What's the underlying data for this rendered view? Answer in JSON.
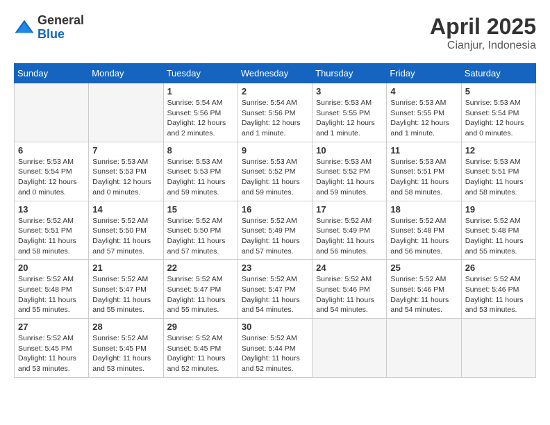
{
  "header": {
    "logo_general": "General",
    "logo_blue": "Blue",
    "month_year": "April 2025",
    "location": "Cianjur, Indonesia"
  },
  "days_of_week": [
    "Sunday",
    "Monday",
    "Tuesday",
    "Wednesday",
    "Thursday",
    "Friday",
    "Saturday"
  ],
  "weeks": [
    [
      {
        "day": "",
        "info": ""
      },
      {
        "day": "",
        "info": ""
      },
      {
        "day": "1",
        "info": "Sunrise: 5:54 AM\nSunset: 5:56 PM\nDaylight: 12 hours and 2 minutes."
      },
      {
        "day": "2",
        "info": "Sunrise: 5:54 AM\nSunset: 5:56 PM\nDaylight: 12 hours and 1 minute."
      },
      {
        "day": "3",
        "info": "Sunrise: 5:53 AM\nSunset: 5:55 PM\nDaylight: 12 hours and 1 minute."
      },
      {
        "day": "4",
        "info": "Sunrise: 5:53 AM\nSunset: 5:55 PM\nDaylight: 12 hours and 1 minute."
      },
      {
        "day": "5",
        "info": "Sunrise: 5:53 AM\nSunset: 5:54 PM\nDaylight: 12 hours and 0 minutes."
      }
    ],
    [
      {
        "day": "6",
        "info": "Sunrise: 5:53 AM\nSunset: 5:54 PM\nDaylight: 12 hours and 0 minutes."
      },
      {
        "day": "7",
        "info": "Sunrise: 5:53 AM\nSunset: 5:53 PM\nDaylight: 12 hours and 0 minutes."
      },
      {
        "day": "8",
        "info": "Sunrise: 5:53 AM\nSunset: 5:53 PM\nDaylight: 11 hours and 59 minutes."
      },
      {
        "day": "9",
        "info": "Sunrise: 5:53 AM\nSunset: 5:52 PM\nDaylight: 11 hours and 59 minutes."
      },
      {
        "day": "10",
        "info": "Sunrise: 5:53 AM\nSunset: 5:52 PM\nDaylight: 11 hours and 59 minutes."
      },
      {
        "day": "11",
        "info": "Sunrise: 5:53 AM\nSunset: 5:51 PM\nDaylight: 11 hours and 58 minutes."
      },
      {
        "day": "12",
        "info": "Sunrise: 5:53 AM\nSunset: 5:51 PM\nDaylight: 11 hours and 58 minutes."
      }
    ],
    [
      {
        "day": "13",
        "info": "Sunrise: 5:52 AM\nSunset: 5:51 PM\nDaylight: 11 hours and 58 minutes."
      },
      {
        "day": "14",
        "info": "Sunrise: 5:52 AM\nSunset: 5:50 PM\nDaylight: 11 hours and 57 minutes."
      },
      {
        "day": "15",
        "info": "Sunrise: 5:52 AM\nSunset: 5:50 PM\nDaylight: 11 hours and 57 minutes."
      },
      {
        "day": "16",
        "info": "Sunrise: 5:52 AM\nSunset: 5:49 PM\nDaylight: 11 hours and 57 minutes."
      },
      {
        "day": "17",
        "info": "Sunrise: 5:52 AM\nSunset: 5:49 PM\nDaylight: 11 hours and 56 minutes."
      },
      {
        "day": "18",
        "info": "Sunrise: 5:52 AM\nSunset: 5:48 PM\nDaylight: 11 hours and 56 minutes."
      },
      {
        "day": "19",
        "info": "Sunrise: 5:52 AM\nSunset: 5:48 PM\nDaylight: 11 hours and 55 minutes."
      }
    ],
    [
      {
        "day": "20",
        "info": "Sunrise: 5:52 AM\nSunset: 5:48 PM\nDaylight: 11 hours and 55 minutes."
      },
      {
        "day": "21",
        "info": "Sunrise: 5:52 AM\nSunset: 5:47 PM\nDaylight: 11 hours and 55 minutes."
      },
      {
        "day": "22",
        "info": "Sunrise: 5:52 AM\nSunset: 5:47 PM\nDaylight: 11 hours and 55 minutes."
      },
      {
        "day": "23",
        "info": "Sunrise: 5:52 AM\nSunset: 5:47 PM\nDaylight: 11 hours and 54 minutes."
      },
      {
        "day": "24",
        "info": "Sunrise: 5:52 AM\nSunset: 5:46 PM\nDaylight: 11 hours and 54 minutes."
      },
      {
        "day": "25",
        "info": "Sunrise: 5:52 AM\nSunset: 5:46 PM\nDaylight: 11 hours and 54 minutes."
      },
      {
        "day": "26",
        "info": "Sunrise: 5:52 AM\nSunset: 5:46 PM\nDaylight: 11 hours and 53 minutes."
      }
    ],
    [
      {
        "day": "27",
        "info": "Sunrise: 5:52 AM\nSunset: 5:45 PM\nDaylight: 11 hours and 53 minutes."
      },
      {
        "day": "28",
        "info": "Sunrise: 5:52 AM\nSunset: 5:45 PM\nDaylight: 11 hours and 53 minutes."
      },
      {
        "day": "29",
        "info": "Sunrise: 5:52 AM\nSunset: 5:45 PM\nDaylight: 11 hours and 52 minutes."
      },
      {
        "day": "30",
        "info": "Sunrise: 5:52 AM\nSunset: 5:44 PM\nDaylight: 11 hours and 52 minutes."
      },
      {
        "day": "",
        "info": ""
      },
      {
        "day": "",
        "info": ""
      },
      {
        "day": "",
        "info": ""
      }
    ]
  ]
}
